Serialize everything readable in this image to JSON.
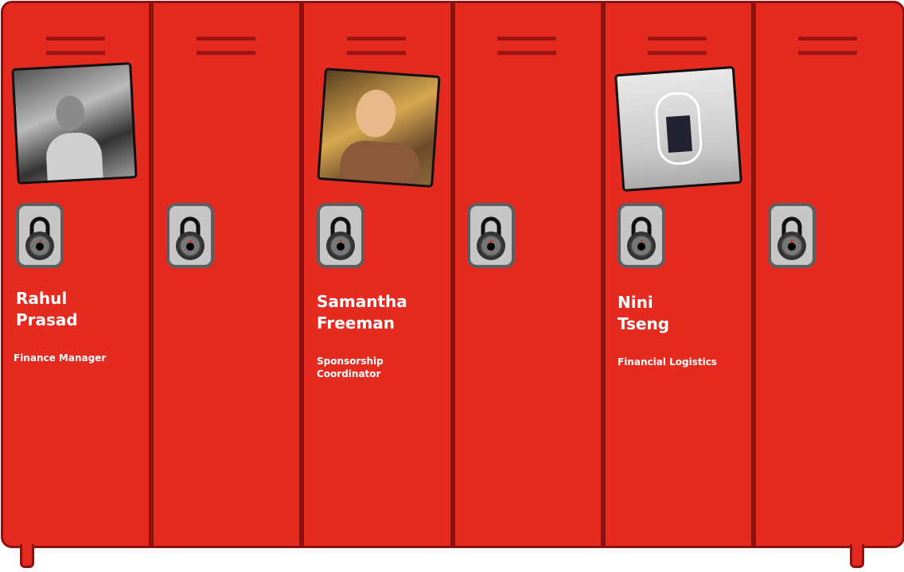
{
  "members": [
    {
      "first": "Rahul",
      "last": "Prasad",
      "role": "Finance Manager"
    },
    {
      "first": "Samantha",
      "last": "Freeman",
      "role_line1": "Sponsorship",
      "role_line2": "Coordinator"
    },
    {
      "first": "Nini",
      "last": "Tseng",
      "role": "Financial Logistics"
    }
  ],
  "colors": {
    "locker": "#e52b20",
    "border": "#8c1212",
    "lock": "#c6c6c6"
  }
}
